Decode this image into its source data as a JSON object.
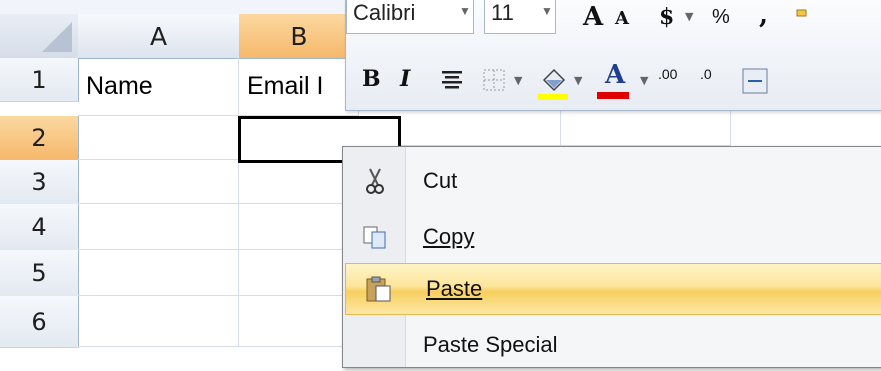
{
  "sheet": {
    "columns": [
      "A",
      "B"
    ],
    "rows": [
      "1",
      "2",
      "3",
      "4",
      "5",
      "6"
    ],
    "cells": {
      "A1": "Name",
      "B1": "Email I"
    }
  },
  "toolbar": {
    "font_name": "Calibri",
    "font_size": "11",
    "dollar": "$",
    "percent": "%",
    "comma": ",",
    "bold": "B",
    "italic": "I",
    "grow_font": "A",
    "shrink_font": "A",
    "font_color_letter": "A",
    "inc_decimal": ".00",
    "dec_decimal": ".0"
  },
  "context_menu": {
    "items": [
      {
        "label": "Cut",
        "icon": "scissors-icon"
      },
      {
        "label": "Copy",
        "icon": "copy-icon"
      },
      {
        "label": "Paste",
        "icon": "paste-icon"
      },
      {
        "label": "Paste Special",
        "icon": ""
      }
    ]
  },
  "colors": {
    "fill_highlight": "#ffff00",
    "font_color": "#e00000",
    "selected_header": "#f6b86b"
  }
}
